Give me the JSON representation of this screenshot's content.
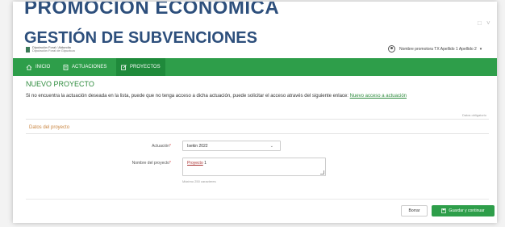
{
  "header": {
    "brand_line1": "PROMOCIÓN ECONÓMICA",
    "brand_line2": "GESTIÓN DE SUBVENCIONES",
    "logo_text": "Diputación Foral / Aldundia",
    "logo_subtext": "Diputación Foral de Gipuzkoa",
    "user_name": "Nombre promotora TX Apellido 1 Apellido 2",
    "user_caret": "▾",
    "win_min": "□",
    "win_caret": "˅"
  },
  "nav": {
    "items": [
      {
        "label": "INICIO",
        "icon": "home-icon"
      },
      {
        "label": "ACTUACIONES",
        "icon": "document-icon"
      },
      {
        "label": "PROYECTOS",
        "icon": "edit-icon"
      }
    ]
  },
  "main": {
    "title": "NUEVO PROYECTO",
    "intro_text": "Si no encuentra la actuación deseada en la lista, puede que no tenga acceso a dicha actuación, puede solicitar el acceso através del siguiente enlace:",
    "intro_link": "Nuevo acceso a actuación",
    "required_note": "Datos obligatorio",
    "section_title": "Datos del proyecto",
    "actuacion_label": "Actuación",
    "actuacion_value": "Isekin 2022",
    "nombre_label": "Nombre del proyecto",
    "nombre_value_link": "Proyecto",
    "nombre_value_rest": " 1",
    "nombre_hint": "Máximo 250 caracteres",
    "required_mark": "*",
    "reset_label": "Borrar",
    "save_label": "Guardar y continuar"
  },
  "colors": {
    "brand": "#2d4f7c",
    "accent": "#2e9e4a",
    "section": "#c9843f"
  }
}
